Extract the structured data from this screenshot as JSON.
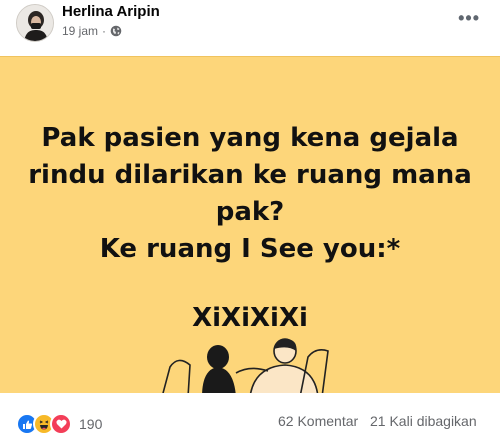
{
  "post": {
    "author": "Herlina Aripin",
    "time": "19 jam",
    "privacy_icon": "globe-icon",
    "more_icon": "more-options-icon"
  },
  "image": {
    "background_color": "#fdd67a",
    "lines": [
      "Pak pasien yang kena gejala",
      "rindu dilarikan ke ruang mana",
      "pak?",
      "Ke ruang I See you:*"
    ],
    "laugh": "XiXiXiXi"
  },
  "engagement": {
    "reactions": [
      "like-icon",
      "haha-icon",
      "love-icon"
    ],
    "reaction_count": "190",
    "comments": "62 Komentar",
    "shares": "21 Kali dibagikan"
  }
}
